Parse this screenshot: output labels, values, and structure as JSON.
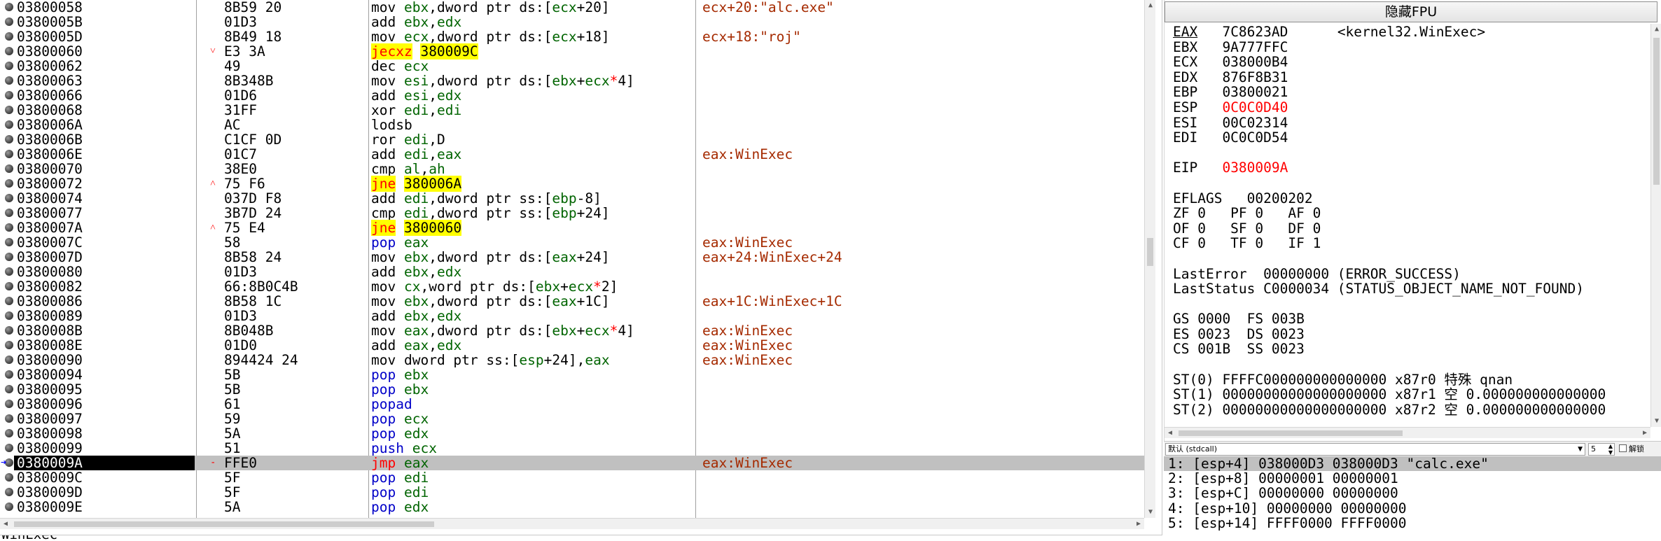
{
  "disasm": {
    "rows": [
      {
        "addr": "03800058",
        "mark": "",
        "bytes": "8B59 20",
        "mn": "mov",
        "ops": "ebx,dword ptr ds:[ecx+20]",
        "comment": "ecx+20:\"alc.exe\""
      },
      {
        "addr": "0380005B",
        "mark": "",
        "bytes": "01D3",
        "mn": "add",
        "ops": "ebx,edx",
        "comment": ""
      },
      {
        "addr": "0380005D",
        "mark": "",
        "bytes": "8B49 18",
        "mn": "mov",
        "ops": "ecx,dword ptr ds:[ecx+18]",
        "comment": "ecx+18:\"roj\""
      },
      {
        "addr": "03800060",
        "mark": "˅",
        "bytes": "E3 3A",
        "mn": "jecxz",
        "ops": "380009C",
        "comment": ""
      },
      {
        "addr": "03800062",
        "mark": "",
        "bytes": "49",
        "mn": "dec",
        "ops": "ecx",
        "comment": ""
      },
      {
        "addr": "03800063",
        "mark": "",
        "bytes": "8B348B",
        "mn": "mov",
        "ops": "esi,dword ptr ds:[ebx+ecx*4]",
        "comment": ""
      },
      {
        "addr": "03800066",
        "mark": "",
        "bytes": "01D6",
        "mn": "add",
        "ops": "esi,edx",
        "comment": ""
      },
      {
        "addr": "03800068",
        "mark": "",
        "bytes": "31FF",
        "mn": "xor",
        "ops": "edi,edi",
        "comment": ""
      },
      {
        "addr": "0380006A",
        "mark": "",
        "bytes": "AC",
        "mn": "lodsb",
        "ops": "",
        "comment": ""
      },
      {
        "addr": "0380006B",
        "mark": "",
        "bytes": "C1CF 0D",
        "mn": "ror",
        "ops": "edi,D",
        "comment": ""
      },
      {
        "addr": "0380006E",
        "mark": "",
        "bytes": "01C7",
        "mn": "add",
        "ops": "edi,eax",
        "comment": "eax:WinExec"
      },
      {
        "addr": "03800070",
        "mark": "",
        "bytes": "38E0",
        "mn": "cmp",
        "ops": "al,ah",
        "comment": ""
      },
      {
        "addr": "03800072",
        "mark": "˄",
        "bytes": "75 F6",
        "mn": "jne",
        "ops": "380006A",
        "comment": ""
      },
      {
        "addr": "03800074",
        "mark": "",
        "bytes": "037D F8",
        "mn": "add",
        "ops": "edi,dword ptr ss:[ebp-8]",
        "comment": ""
      },
      {
        "addr": "03800077",
        "mark": "",
        "bytes": "3B7D 24",
        "mn": "cmp",
        "ops": "edi,dword ptr ss:[ebp+24]",
        "comment": ""
      },
      {
        "addr": "0380007A",
        "mark": "˄",
        "bytes": "75 E4",
        "mn": "jne",
        "ops": "3800060",
        "comment": ""
      },
      {
        "addr": "0380007C",
        "mark": "",
        "bytes": "58",
        "mn": "pop",
        "ops": "eax",
        "comment": "eax:WinExec"
      },
      {
        "addr": "0380007D",
        "mark": "",
        "bytes": "8B58 24",
        "mn": "mov",
        "ops": "ebx,dword ptr ds:[eax+24]",
        "comment": "eax+24:WinExec+24"
      },
      {
        "addr": "03800080",
        "mark": "",
        "bytes": "01D3",
        "mn": "add",
        "ops": "ebx,edx",
        "comment": ""
      },
      {
        "addr": "03800082",
        "mark": "",
        "bytes": "66:8B0C4B",
        "mn": "mov",
        "ops": "cx,word ptr ds:[ebx+ecx*2]",
        "comment": ""
      },
      {
        "addr": "03800086",
        "mark": "",
        "bytes": "8B58 1C",
        "mn": "mov",
        "ops": "ebx,dword ptr ds:[eax+1C]",
        "comment": "eax+1C:WinExec+1C"
      },
      {
        "addr": "03800089",
        "mark": "",
        "bytes": "01D3",
        "mn": "add",
        "ops": "ebx,edx",
        "comment": ""
      },
      {
        "addr": "0380008B",
        "mark": "",
        "bytes": "8B048B",
        "mn": "mov",
        "ops": "eax,dword ptr ds:[ebx+ecx*4]",
        "comment": "eax:WinExec"
      },
      {
        "addr": "0380008E",
        "mark": "",
        "bytes": "01D0",
        "mn": "add",
        "ops": "eax,edx",
        "comment": "eax:WinExec"
      },
      {
        "addr": "03800090",
        "mark": "",
        "bytes": "894424 24",
        "mn": "mov",
        "ops": "dword ptr ss:[esp+24],eax",
        "comment": "eax:WinExec"
      },
      {
        "addr": "03800094",
        "mark": "",
        "bytes": "5B",
        "mn": "pop",
        "ops": "ebx",
        "comment": ""
      },
      {
        "addr": "03800095",
        "mark": "",
        "bytes": "5B",
        "mn": "pop",
        "ops": "ebx",
        "comment": ""
      },
      {
        "addr": "03800096",
        "mark": "",
        "bytes": "61",
        "mn": "popad",
        "ops": "",
        "comment": ""
      },
      {
        "addr": "03800097",
        "mark": "",
        "bytes": "59",
        "mn": "pop",
        "ops": "ecx",
        "comment": ""
      },
      {
        "addr": "03800098",
        "mark": "",
        "bytes": "5A",
        "mn": "pop",
        "ops": "edx",
        "comment": ""
      },
      {
        "addr": "03800099",
        "mark": "",
        "bytes": "51",
        "mn": "push",
        "ops": "ecx",
        "comment": ""
      },
      {
        "addr": "0380009A",
        "mark": "-",
        "bytes": "FFE0",
        "mn": "jmp",
        "ops": "eax",
        "comment": "eax:WinExec",
        "current": true
      },
      {
        "addr": "0380009C",
        "mark": "",
        "bytes": "5F",
        "mn": "pop",
        "ops": "edi",
        "comment": ""
      },
      {
        "addr": "0380009D",
        "mark": "",
        "bytes": "5F",
        "mn": "pop",
        "ops": "edi",
        "comment": ""
      },
      {
        "addr": "0380009E",
        "mark": "",
        "bytes": "5A",
        "mn": "pop",
        "ops": "edx",
        "comment": ""
      }
    ]
  },
  "fpu_button": "隐藏FPU",
  "registers": {
    "lines": [
      {
        "segs": [
          {
            "t": "EAX",
            "c": "u"
          },
          {
            "t": "   7C8623AD      <kernel32.WinExec>"
          }
        ]
      },
      {
        "segs": [
          {
            "t": "EBX   9A777FFC"
          }
        ]
      },
      {
        "segs": [
          {
            "t": "ECX   038000B4"
          }
        ]
      },
      {
        "segs": [
          {
            "t": "EDX   876F8B31"
          }
        ]
      },
      {
        "segs": [
          {
            "t": "EBP   03800021"
          }
        ]
      },
      {
        "segs": [
          {
            "t": "ESP   "
          },
          {
            "t": "0C0C0D40",
            "c": "red"
          }
        ]
      },
      {
        "segs": [
          {
            "t": "ESI   00C02314"
          }
        ]
      },
      {
        "segs": [
          {
            "t": "EDI   0C0C0D54"
          }
        ]
      },
      {
        "segs": [
          {
            "t": ""
          }
        ]
      },
      {
        "segs": [
          {
            "t": "EIP   "
          },
          {
            "t": "0380009A",
            "c": "red"
          }
        ]
      },
      {
        "segs": [
          {
            "t": ""
          }
        ]
      },
      {
        "segs": [
          {
            "t": "EFLAGS   00200202"
          }
        ]
      },
      {
        "segs": [
          {
            "t": "ZF 0   PF 0   AF 0"
          }
        ]
      },
      {
        "segs": [
          {
            "t": "OF 0   SF 0   DF 0"
          }
        ]
      },
      {
        "segs": [
          {
            "t": "CF 0   TF 0   IF 1"
          }
        ]
      },
      {
        "segs": [
          {
            "t": ""
          }
        ]
      },
      {
        "segs": [
          {
            "t": "LastError  00000000 (ERROR_SUCCESS)"
          }
        ]
      },
      {
        "segs": [
          {
            "t": "LastStatus C0000034 (STATUS_OBJECT_NAME_NOT_FOUND)"
          }
        ]
      },
      {
        "segs": [
          {
            "t": ""
          }
        ]
      },
      {
        "segs": [
          {
            "t": "GS 0000  FS 003B"
          }
        ]
      },
      {
        "segs": [
          {
            "t": "ES 0023  DS 0023"
          }
        ]
      },
      {
        "segs": [
          {
            "t": "CS 001B  SS 0023"
          }
        ]
      },
      {
        "segs": [
          {
            "t": ""
          }
        ]
      },
      {
        "segs": [
          {
            "t": "ST(0) FFFFC000000000000000 x87r0 特殊 qnan"
          }
        ]
      },
      {
        "segs": [
          {
            "t": "ST(1) 00000000000000000000 x87r1 空 0.000000000000000"
          }
        ]
      },
      {
        "segs": [
          {
            "t": "ST(2) 00000000000000000000 x87r2 空 0.000000000000000"
          }
        ]
      }
    ]
  },
  "callconv": {
    "selected": "默认 (stdcall)",
    "count": "5",
    "unlock_label": "解锁"
  },
  "stack": {
    "rows": [
      "1: [esp+4] 038000D3 038000D3 \"calc.exe\"",
      "2: [esp+8] 00000001 00000001",
      "3: [esp+C] 00000000 00000000",
      "4: [esp+10] 00000000 00000000",
      "5: [esp+14] FFFF0000 FFFF0000"
    ]
  },
  "status_text": "WinExec"
}
